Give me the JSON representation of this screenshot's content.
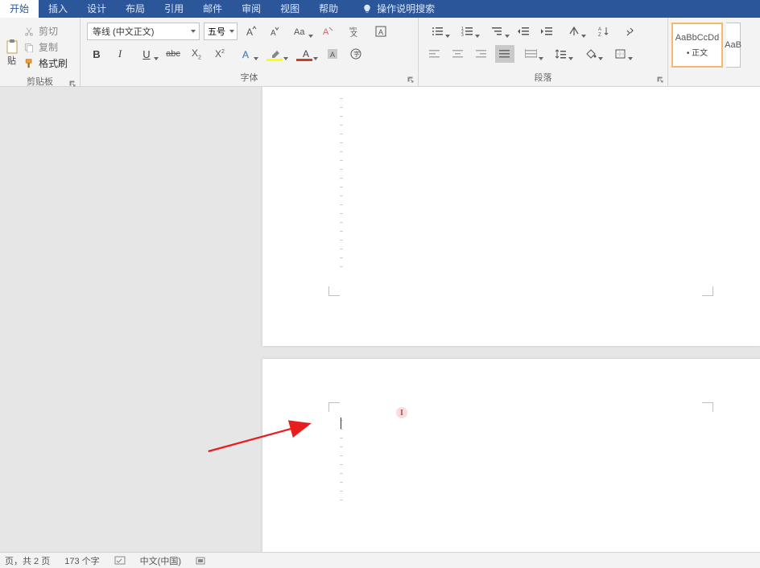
{
  "menu": {
    "tabs": [
      "开始",
      "插入",
      "设计",
      "布局",
      "引用",
      "邮件",
      "审阅",
      "视图",
      "帮助"
    ],
    "active_index": 0,
    "tell_me": "操作说明搜索"
  },
  "clipboard": {
    "paste": "贴",
    "cut": "剪切",
    "copy": "复制",
    "format_painter": "格式刷",
    "group_label": "剪贴板"
  },
  "font": {
    "name": "等线 (中文正文)",
    "size": "五号",
    "group_label": "字体"
  },
  "paragraph": {
    "group_label": "段落"
  },
  "styles": {
    "items": [
      {
        "preview": "AaBbCcDd",
        "name": "• 正文"
      },
      {
        "preview": "AaB",
        "name": ""
      }
    ]
  },
  "status": {
    "page": "页，共 2 页",
    "words": "173 个字",
    "language": "中文(中国)"
  },
  "colors": {
    "ribbon_accent": "#2b579a",
    "highlight": "#ffff00",
    "font_color": "#d13a25"
  }
}
